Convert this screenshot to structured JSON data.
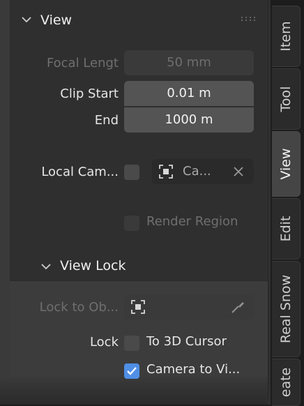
{
  "panel": {
    "title": "View",
    "focal_length": {
      "label": "Focal Lengt",
      "value": "50 mm"
    },
    "clip_start": {
      "label": "Clip Start",
      "value": "0.01 m"
    },
    "clip_end": {
      "label": "End",
      "value": "1000 m"
    },
    "local_camera": {
      "label": "Local Cam...",
      "object": "Ca...",
      "checked": false
    },
    "render_region": {
      "label": "Render Region",
      "checked": false
    }
  },
  "view_lock": {
    "title": "View Lock",
    "lock_to_object": {
      "label": "Lock to Ob..."
    },
    "lock": {
      "label": "Lock"
    },
    "to_3d_cursor": {
      "label": "To 3D Cursor",
      "checked": false
    },
    "camera_to_view": {
      "label": "Camera to Vi...",
      "checked": true
    }
  },
  "tabs": [
    {
      "label": "Item",
      "active": false
    },
    {
      "label": "Tool",
      "active": false
    },
    {
      "label": "View",
      "active": true
    },
    {
      "label": "Edit",
      "active": false
    },
    {
      "label": "Real Snow",
      "active": false
    },
    {
      "label": "eate",
      "active": false
    }
  ],
  "colors": {
    "accent": "#4f8fe6",
    "panel_bg": "#2f2f2f",
    "field_bg": "#545454",
    "disabled_text": "#6f6f6f"
  },
  "icons": {
    "collapse": "chevron-down-icon",
    "drag": "grip-icon",
    "camera_object": "object-data-icon",
    "clear": "close-icon",
    "eyedropper": "eyedropper-icon",
    "checkmark": "check-icon"
  }
}
